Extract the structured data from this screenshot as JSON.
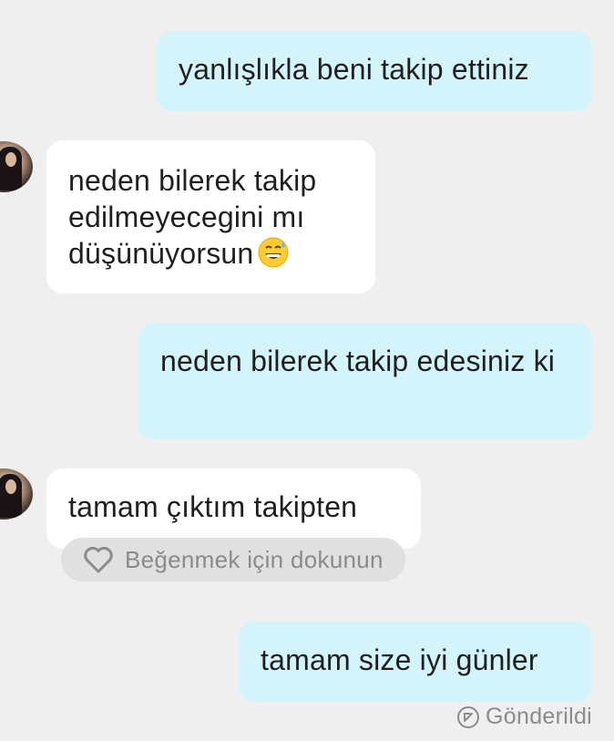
{
  "messages": [
    {
      "direction": "outgoing",
      "text": "yanlışlıkla beni takip ettiniz"
    },
    {
      "direction": "incoming",
      "text": "neden bilerek takip edilmeyecegini mı düşünüyorsun",
      "emoji": "grinning-sweat-emoji"
    },
    {
      "direction": "outgoing",
      "text": "neden bilerek takip edesiniz ki"
    },
    {
      "direction": "incoming",
      "text": "tamam çıktım takipten"
    },
    {
      "direction": "outgoing",
      "text": "tamam size iyi günler"
    }
  ],
  "like_prompt": {
    "label": "Beğenmek için dokunun",
    "icon": "heart-outline-icon"
  },
  "sent_status": {
    "label": "Gönderildi",
    "icon": "sent-arrow-icon"
  },
  "colors": {
    "background": "#efefef",
    "outgoing_bubble": "#d4f4fb",
    "incoming_bubble": "#ffffff",
    "like_pill": "#e0e0e0",
    "muted_text": "#8b8b8b"
  }
}
